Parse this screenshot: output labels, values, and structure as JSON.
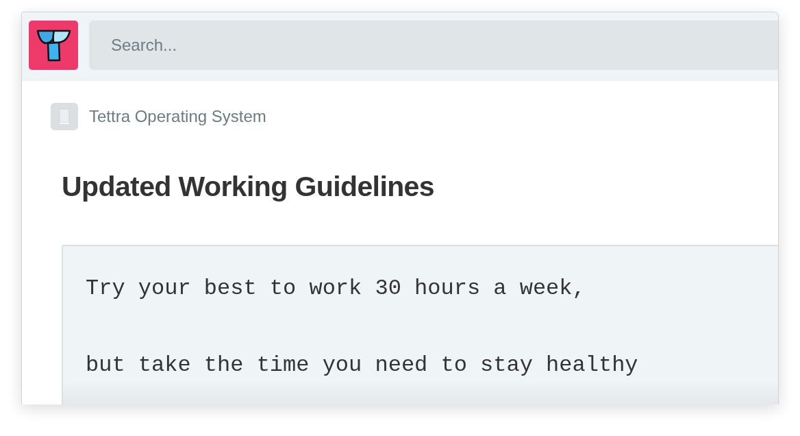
{
  "header": {
    "search": {
      "placeholder": "Search..."
    }
  },
  "breadcrumb": {
    "label": "Tettra Operating System"
  },
  "page": {
    "title": "Updated Working Guidelines",
    "code_block": {
      "lines": [
        "Try your best to work 30 hours a week,",
        "but take the time you need to stay healthy"
      ]
    }
  }
}
